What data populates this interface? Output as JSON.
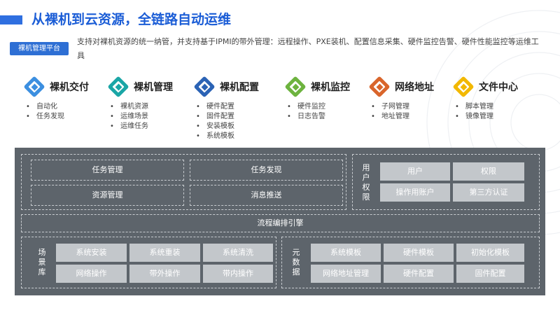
{
  "title": "从裸机到云资源，全链路自动运维",
  "badge": "裸机管理平台",
  "description": "支持对裸机资源的统一纳管，并支持基于IPMI的带外管理：远程操作、PXE装机、配置信息采集、硬件监控告警、硬件性能监控等运维工具",
  "colors": {
    "title": "#1b5dd6",
    "badge": "#2e6fd4",
    "panel": "#5d646b",
    "box": "#c3c7cb"
  },
  "features": [
    {
      "name": "裸机交付",
      "icon": "diamond-icon",
      "color": "#3c8fe0",
      "items": [
        "自动化",
        "任务发现"
      ]
    },
    {
      "name": "裸机管理",
      "icon": "diamond-icon",
      "color": "#1aa6a6",
      "items": [
        "裸机资源",
        "运维场景",
        "运维任务"
      ]
    },
    {
      "name": "裸机配置",
      "icon": "diamond-icon",
      "color": "#2b63b5",
      "items": [
        "硬件配置",
        "固件配置",
        "安装模板",
        "系统模板"
      ]
    },
    {
      "name": "裸机监控",
      "icon": "diamond-icon",
      "color": "#6db33f",
      "items": [
        "硬件监控",
        "日志告警"
      ]
    },
    {
      "name": "网络地址",
      "icon": "diamond-icon",
      "color": "#d9652b",
      "items": [
        "子网管理",
        "地址管理"
      ]
    },
    {
      "name": "文件中心",
      "icon": "diamond-icon",
      "color": "#f2b800",
      "items": [
        "脚本管理",
        "镜像管理"
      ]
    }
  ],
  "diagram": {
    "top_cells": [
      "任务管理",
      "任务发现",
      "资源管理",
      "消息推送"
    ],
    "auth": {
      "label": [
        "用",
        "户",
        "权",
        "限"
      ],
      "items": [
        "用户",
        "权限",
        "操作用账户",
        "第三方认证"
      ]
    },
    "engine": "流程编排引擎",
    "scenario": {
      "label": [
        "场",
        "景",
        "库"
      ],
      "items": [
        "系统安装",
        "系统重装",
        "系统清洗",
        "网络操作",
        "带外操作",
        "带内操作"
      ]
    },
    "metadata": {
      "label": [
        "元",
        "数",
        "据"
      ],
      "items": [
        "系统模板",
        "硬件模板",
        "初始化模板",
        "网络地址管理",
        "硬件配置",
        "固件配置"
      ]
    }
  }
}
